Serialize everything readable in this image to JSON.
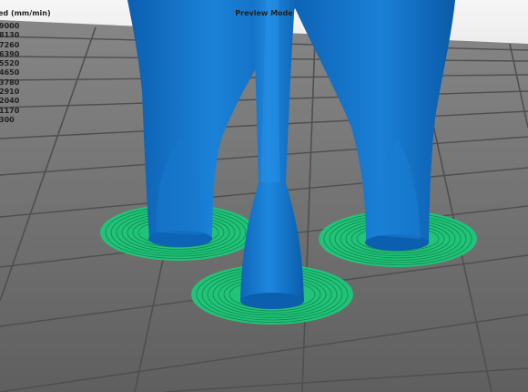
{
  "app": {
    "mode_label": "Preview Mode"
  },
  "legend": {
    "title": "ed (mm/min)",
    "values": [
      "9000",
      "8130",
      "7260",
      "6390",
      "5520",
      "4650",
      "3780",
      "2910",
      "2040",
      "1170",
      "300"
    ]
  },
  "colors": {
    "background_top": "#f2f2f2",
    "bed": "#717171",
    "bed_grid": "#505050",
    "model": "#1472c4",
    "brim": "#22c279"
  }
}
